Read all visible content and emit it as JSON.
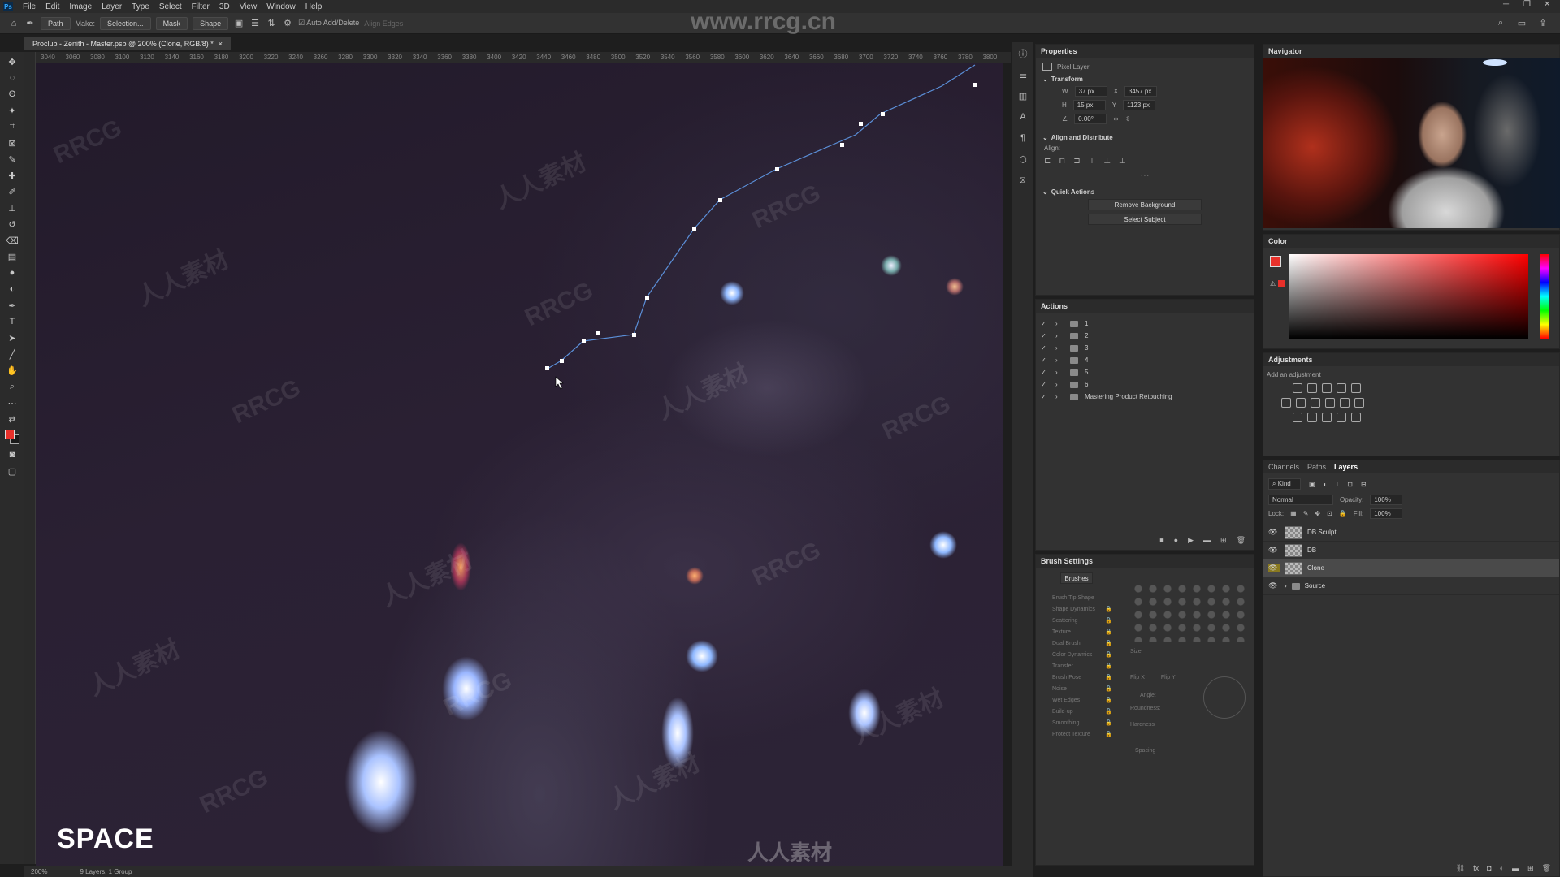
{
  "app": {
    "menus": [
      "File",
      "Edit",
      "Image",
      "Layer",
      "Type",
      "Select",
      "Filter",
      "3D",
      "View",
      "Window",
      "Help"
    ]
  },
  "options_bar": {
    "tool_mode": "Path",
    "make_label": "Make:",
    "selection_btn": "Selection...",
    "mask_btn": "Mask",
    "shape_btn": "Shape",
    "auto_add_delete": "Auto Add/Delete",
    "align_edges": "Align Edges"
  },
  "document": {
    "tab_title": "Proclub - Zenith - Master.psb @ 200% (Clone, RGB/8) *",
    "ruler_ticks": [
      "3040",
      "3060",
      "3080",
      "3100",
      "3120",
      "3140",
      "3160",
      "3180",
      "3200",
      "3220",
      "3240",
      "3260",
      "3280",
      "3300",
      "3320",
      "3340",
      "3360",
      "3380",
      "3400",
      "3420",
      "3440",
      "3460",
      "3480",
      "3500",
      "3520",
      "3540",
      "3560",
      "3580",
      "3600",
      "3620",
      "3640",
      "3660",
      "3680",
      "3700",
      "3720",
      "3740",
      "3760",
      "3780",
      "3800"
    ],
    "zoom": "200%",
    "layer_info": "9 Layers, 1 Group",
    "overlay_key": "SPACE"
  },
  "properties": {
    "title": "Properties",
    "kind": "Pixel Layer",
    "transform_title": "Transform",
    "w_label": "W",
    "w": "37 px",
    "x_label": "X",
    "x": "3457 px",
    "h_label": "H",
    "h": "15 px",
    "y_label": "Y",
    "y": "1123 px",
    "angle": "0.00°",
    "align_title": "Align and Distribute",
    "align_label": "Align:",
    "quick_title": "Quick Actions",
    "remove_bg": "Remove Background",
    "select_subject": "Select Subject"
  },
  "actions": {
    "title": "Actions",
    "items": [
      "1",
      "2",
      "3",
      "4",
      "5",
      "6",
      "Mastering Product Retouching"
    ]
  },
  "brush_settings": {
    "title": "Brush Settings",
    "brushes_btn": "Brushes",
    "options": [
      "Brush Tip Shape",
      "Shape Dynamics",
      "Scattering",
      "Texture",
      "Dual Brush",
      "Color Dynamics",
      "Transfer",
      "Brush Pose",
      "Noise",
      "Wet Edges",
      "Build-up",
      "Smoothing",
      "Protect Texture"
    ],
    "size_label": "Size",
    "flip_x": "Flip X",
    "flip_y": "Flip Y",
    "angle_label": "Angle:",
    "roundness_label": "Roundness:",
    "hardness_label": "Hardness",
    "spacing_label": "Spacing"
  },
  "navigator": {
    "title": "Navigator"
  },
  "color": {
    "title": "Color",
    "foreground": "#e8302a",
    "background": "#1a1a1a"
  },
  "adjustments": {
    "title": "Adjustments",
    "subtitle": "Add an adjustment"
  },
  "layers_panel": {
    "tabs": [
      "Channels",
      "Paths",
      "Layers"
    ],
    "filter_kind": "Kind",
    "blend_mode": "Normal",
    "opacity_label": "Opacity:",
    "opacity": "100%",
    "lock_label": "Lock:",
    "fill_label": "Fill:",
    "fill": "100%",
    "layers": [
      {
        "name": "DB Sculpt"
      },
      {
        "name": "DB"
      },
      {
        "name": "Clone"
      },
      {
        "name": "Source"
      }
    ]
  },
  "watermark": {
    "site": "www.rrcg.cn",
    "brand": "RRCG",
    "cn": "人人素材"
  }
}
